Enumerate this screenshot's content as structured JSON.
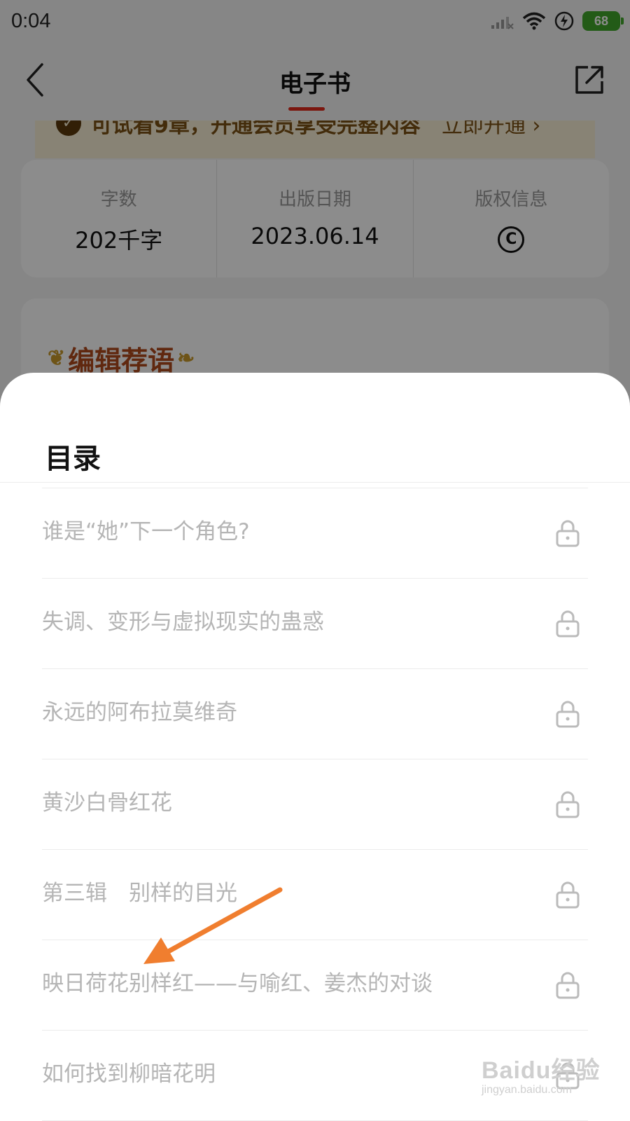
{
  "status_bar": {
    "time": "0:04",
    "battery": "68",
    "icons": [
      "signal-icon",
      "wifi-icon",
      "charging-icon",
      "battery-icon"
    ]
  },
  "nav": {
    "title": "电子书",
    "back_icon": "chevron-left-icon",
    "share_icon": "share-icon",
    "accent_color": "#e0291b"
  },
  "vip_banner": {
    "text": "可试看9章，开通会员享受完整内容",
    "action": "立即开通",
    "action_icon": "chevron-right-icon"
  },
  "book_info": [
    {
      "label": "字数",
      "value": "202千字"
    },
    {
      "label": "出版日期",
      "value": "2023.06.14"
    },
    {
      "label": "版权信息",
      "value": "©"
    }
  ],
  "editor": {
    "title": "编辑荐语"
  },
  "toc": {
    "title": "目录",
    "items": [
      {
        "label": "谁是“她”下一个角色?",
        "locked": true
      },
      {
        "label": "失调、变形与虚拟现实的蛊惑",
        "locked": true
      },
      {
        "label": "永远的阿布拉莫维奇",
        "locked": true
      },
      {
        "label": "黄沙白骨红花",
        "locked": true
      },
      {
        "label": "第三辑　别样的目光",
        "locked": true
      },
      {
        "label": "映日荷花别样红——与喻红、姜杰的对谈",
        "locked": true
      },
      {
        "label": "如何找到柳暗花明",
        "locked": true
      }
    ]
  },
  "watermark": {
    "main": "Baidu经验",
    "sub": "jingyan.baidu.com"
  }
}
